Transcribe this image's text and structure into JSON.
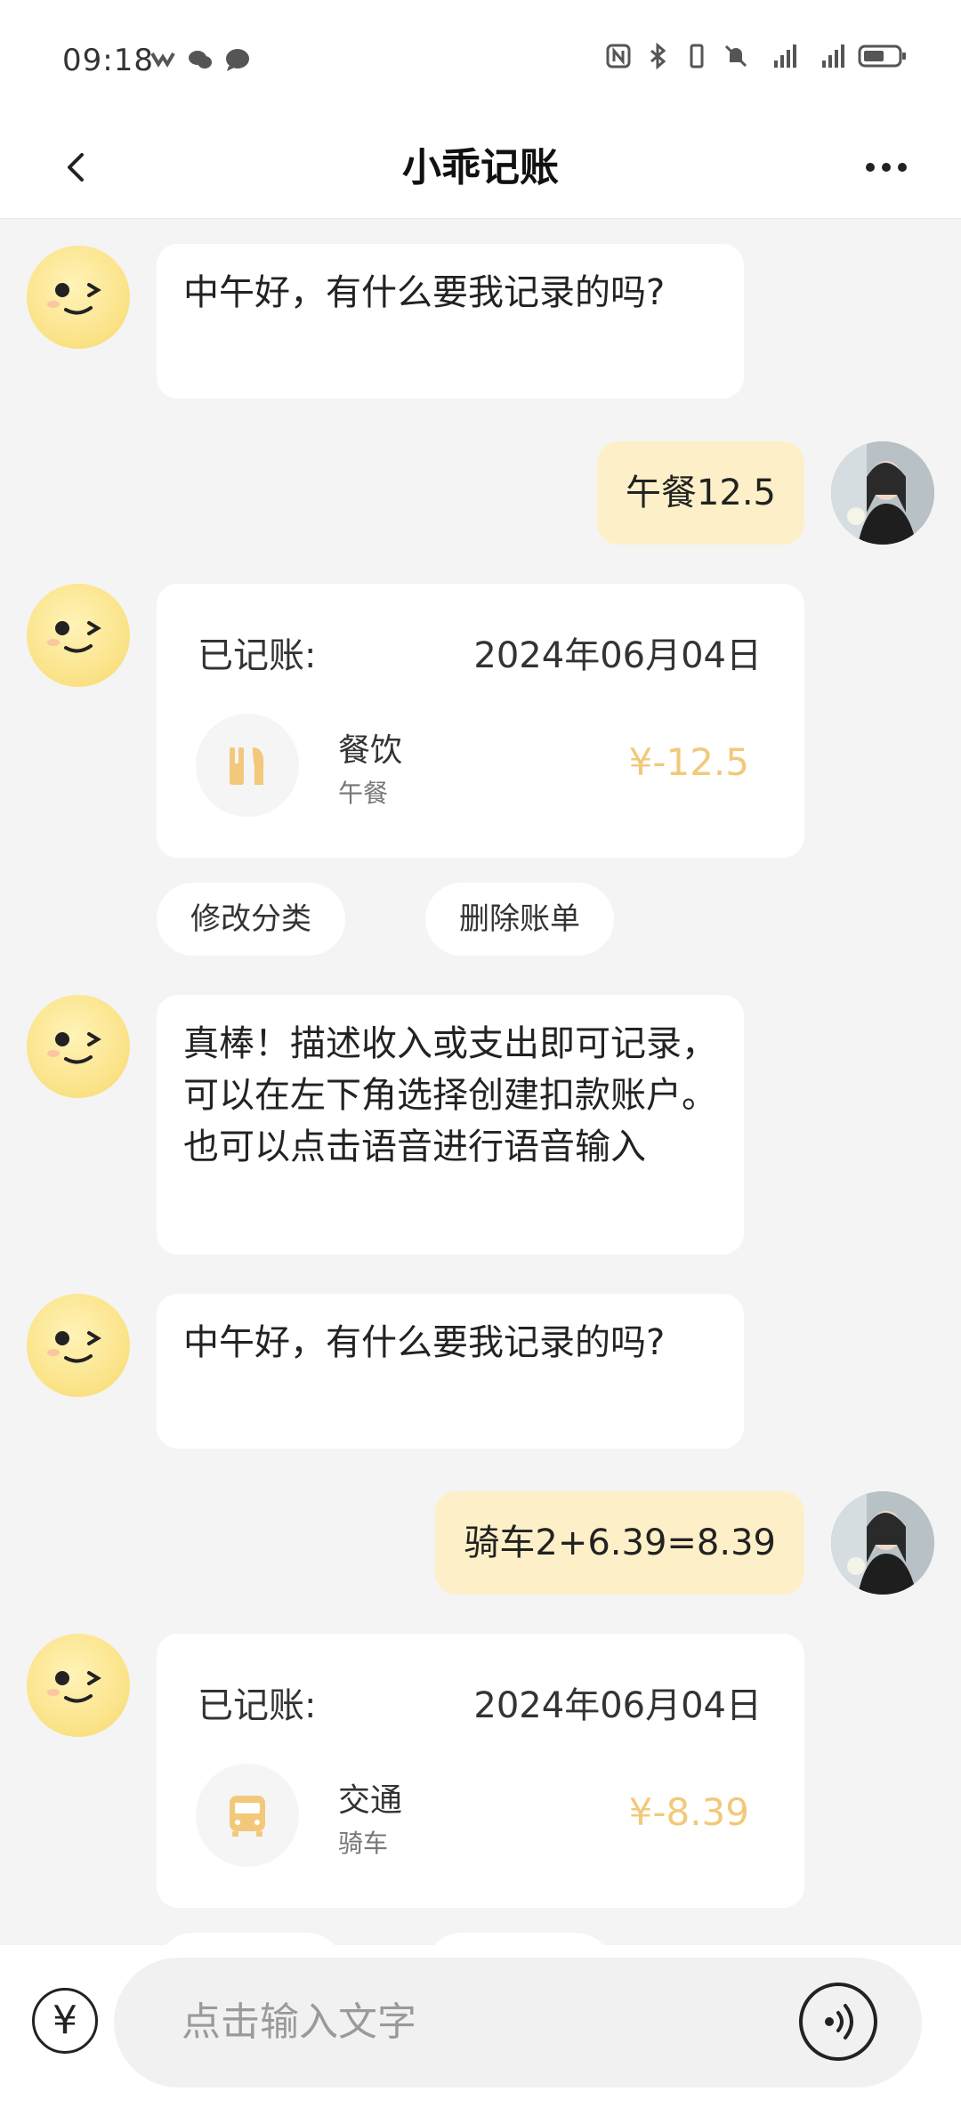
{
  "status_bar": {
    "time": "09:18"
  },
  "header": {
    "title": "小乖记账"
  },
  "chat": {
    "msg1": "中午好，有什么要我记录的吗?",
    "user1": "午餐12.5",
    "card1": {
      "label": "已记账:",
      "date": "2024年06月04日",
      "category": "餐饮",
      "note": "午餐",
      "amount": "¥-12.5"
    },
    "actions": {
      "edit": "修改分类",
      "delete": "删除账单"
    },
    "msg2": "真棒！描述收入或支出即可记录，可以在左下角选择创建扣款账户。也可以点击语音进行语音输入",
    "msg3": "中午好，有什么要我记录的吗?",
    "user2": "骑车2+6.39=8.39",
    "card2": {
      "label": "已记账:",
      "date": "2024年06月04日",
      "category": "交通",
      "note": "骑车",
      "amount": "¥-8.39"
    }
  },
  "input": {
    "yuan_symbol": "¥",
    "placeholder": "点击输入文字"
  },
  "colors": {
    "accent": "#f2c97a",
    "user_bubble": "#fdf0c8",
    "bg": "#f4f4f4"
  }
}
